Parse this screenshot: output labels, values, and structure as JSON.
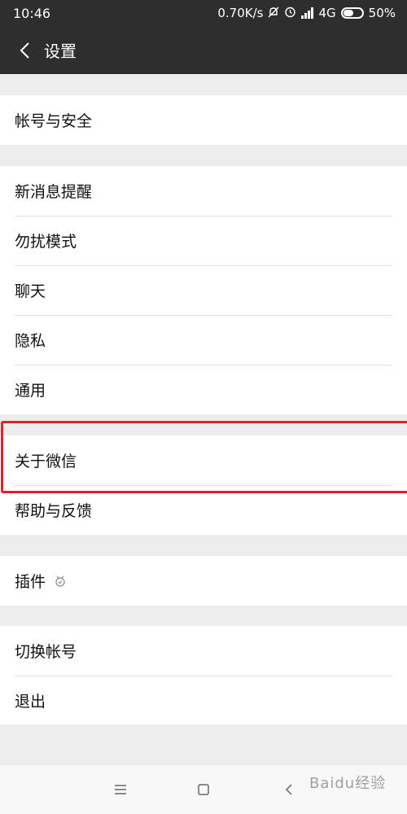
{
  "status_bar": {
    "time": "10:46",
    "speed": "0.70K/s",
    "network": "4G",
    "battery": "50%"
  },
  "header": {
    "title": "设置"
  },
  "groups": [
    {
      "items": [
        {
          "label": "帐号与安全"
        }
      ]
    },
    {
      "items": [
        {
          "label": "新消息提醒"
        },
        {
          "label": "勿扰模式"
        },
        {
          "label": "聊天"
        },
        {
          "label": "隐私"
        },
        {
          "label": "通用"
        }
      ]
    },
    {
      "items": [
        {
          "label": "关于微信"
        },
        {
          "label": "帮助与反馈"
        }
      ]
    },
    {
      "items": [
        {
          "label": "插件"
        }
      ]
    },
    {
      "items": [
        {
          "label": "切换帐号"
        },
        {
          "label": "退出"
        }
      ]
    }
  ],
  "watermark": "Baidu经验",
  "colors": {
    "header_bg": "#2e2e2e",
    "page_bg": "#ededed",
    "highlight": "#e8202a"
  }
}
